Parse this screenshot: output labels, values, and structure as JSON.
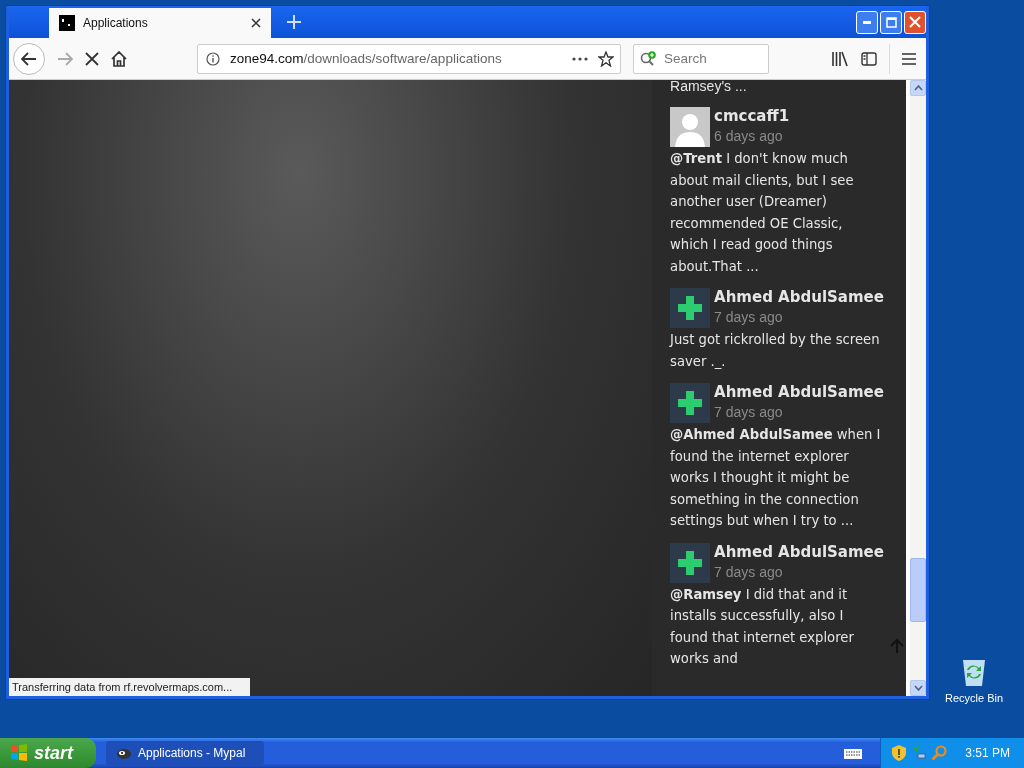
{
  "browser": {
    "tab": {
      "title": "Applications",
      "selected": true
    },
    "loading": true,
    "url_host": "zone94.com",
    "url_path": "/downloads/software/applications",
    "search": {
      "placeholder": "Search"
    }
  },
  "sidebar": {
    "previous_comment_tail": "Ramsey's ...",
    "comments": [
      {
        "author": "cmccaff1",
        "time": "6 days ago",
        "kind": "default",
        "text": "**@Trent** I don't know much about mail clients, but I see another user (Dreamer) recommended OE Classic, which I read good things about.That ..."
      },
      {
        "author": "Ahmed AbdulSamee",
        "time": "7 days ago",
        "kind": "plus",
        "text": "Just got rickrolled by the screen saver ._."
      },
      {
        "author": "Ahmed AbdulSamee",
        "time": "7 days ago",
        "kind": "plus",
        "text": "**@Ahmed AbdulSamee** when I found the internet explorer works I thought it might be something in the connection settings but when I try to ..."
      },
      {
        "author": "Ahmed AbdulSamee",
        "time": "7 days ago",
        "kind": "plus",
        "text": "**@Ramsey** I did that and it installs successfully, also I found that internet explorer works and"
      }
    ]
  },
  "status_bar": "Transferring data from rf.revolvermaps.com...",
  "desktop_icons": [
    {
      "label": "Recycle Bin"
    }
  ],
  "taskbar": {
    "start": "start",
    "tasks": [
      {
        "label": "Applications - Mypal",
        "selected": true
      }
    ],
    "clock": "3:51 PM"
  }
}
